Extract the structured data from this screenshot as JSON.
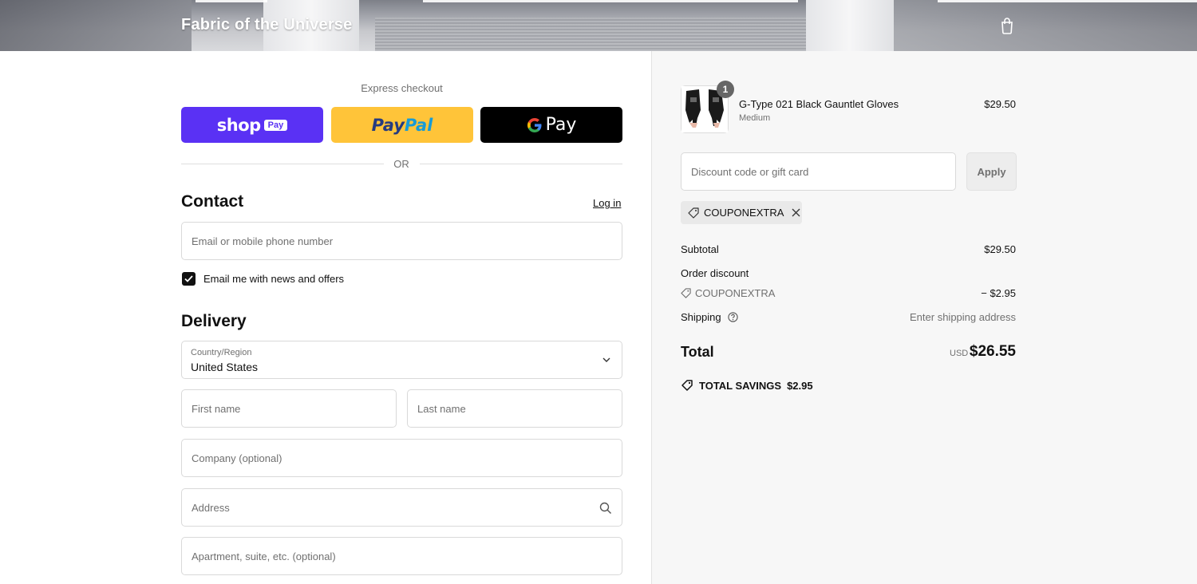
{
  "header": {
    "brand": "Fabric of the Universe",
    "cart_icon": "shopping-bag-icon"
  },
  "express": {
    "label": "Express checkout",
    "shop_pay": {
      "word": "shop",
      "pill": "Pay",
      "color": "#5a31f4"
    },
    "paypal": {
      "word1": "Pay",
      "word2": "Pal",
      "color": "#ffc439"
    },
    "google_pay": {
      "word": "Pay",
      "color": "#000000"
    },
    "or_text": "OR"
  },
  "contact": {
    "title": "Contact",
    "login_label": "Log in",
    "email_placeholder": "Email or mobile phone number",
    "newsletter_label": "Email me with news and offers",
    "newsletter_checked": true
  },
  "delivery": {
    "title": "Delivery",
    "country_label": "Country/Region",
    "country_value": "United States",
    "first_name_placeholder": "First name",
    "last_name_placeholder": "Last name",
    "company_placeholder": "Company (optional)",
    "address_placeholder": "Address",
    "apartment_placeholder": "Apartment, suite, etc. (optional)"
  },
  "summary": {
    "item": {
      "quantity": "1",
      "name": "G-Type 021 Black Gauntlet Gloves",
      "variant": "Medium",
      "price": "$29.50"
    },
    "discount_placeholder": "Discount code or gift card",
    "apply_label": "Apply",
    "applied_code": "COUPONEXTRA",
    "subtotal_label": "Subtotal",
    "subtotal_value": "$29.50",
    "order_discount_label": "Order discount",
    "discount_code": "COUPONEXTRA",
    "discount_value": "− $2.95",
    "shipping_label": "Shipping",
    "shipping_value": "Enter shipping address",
    "total_label": "Total",
    "total_currency": "USD",
    "total_value": "$26.55",
    "savings_label": "TOTAL SAVINGS",
    "savings_value": "$2.95"
  }
}
